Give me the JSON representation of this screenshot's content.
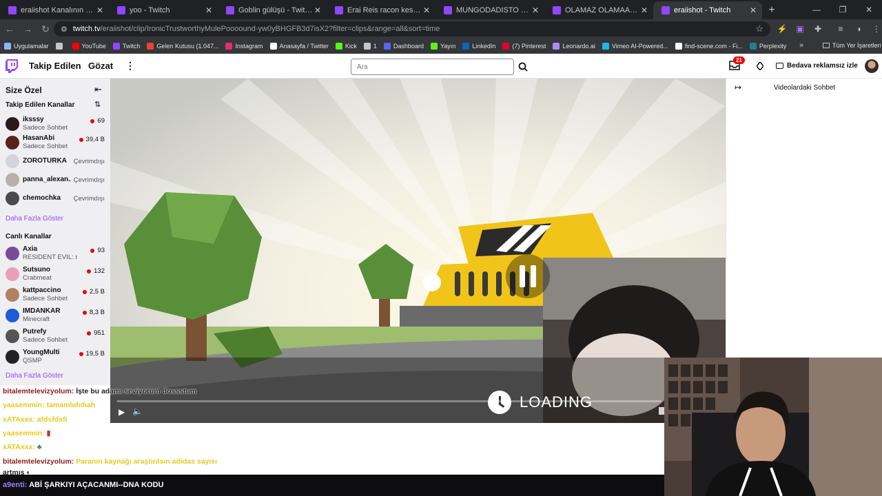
{
  "browser": {
    "tabs": [
      {
        "title": "eraiishot Kanalının Videoları - T",
        "active": false
      },
      {
        "title": "yoo - Twitch",
        "active": false
      },
      {
        "title": "Goblin gülüşü - Twitch",
        "active": false
      },
      {
        "title": "Erai Reis racon kesiyor - Twitch",
        "active": false
      },
      {
        "title": "MUNGODADISTO - Twitch",
        "active": false
      },
      {
        "title": "OLAMAZ OLAMAAZZZZ - Twit",
        "active": false
      },
      {
        "title": "eraiishot - Twitch",
        "active": true
      }
    ],
    "url_host": "twitch.tv",
    "url_path": "/eraiishot/clip/IronicTrustworthyMulePoooound-yw0yBHGFB3d7isX2?filter=clips&range=all&sort=time",
    "bookmarks": [
      {
        "label": "Uygulamalar",
        "color": "#8ab4f8"
      },
      {
        "label": "",
        "color": "#c4c7c5"
      },
      {
        "label": "YouTube",
        "color": "#ff0000"
      },
      {
        "label": "Twitch",
        "color": "#9146ff"
      },
      {
        "label": "Gelen Kutusu (1.047...",
        "color": "#ea4335"
      },
      {
        "label": "Instagram",
        "color": "#e1306c"
      },
      {
        "label": "Anasayfa / Twitter",
        "color": "#ffffff"
      },
      {
        "label": "Kick",
        "color": "#53fc18"
      },
      {
        "label": "1",
        "color": "#c4c7c5"
      },
      {
        "label": "Dashboard",
        "color": "#5865f2"
      },
      {
        "label": "Yayın",
        "color": "#53fc18"
      },
      {
        "label": "LinkedIn",
        "color": "#0a66c2"
      },
      {
        "label": "(7) Pinterest",
        "color": "#e60023"
      },
      {
        "label": "Leonardo.ai",
        "color": "#a98bff"
      },
      {
        "label": "Vimeo AI-Powered...",
        "color": "#1ab7ea"
      },
      {
        "label": "find-scene.com - Fi...",
        "color": "#ffffff"
      },
      {
        "label": "Perplexity",
        "color": "#20808d"
      }
    ],
    "all_bookmarks": "Tüm Yer İşaretleri"
  },
  "twitch": {
    "nav": {
      "following": "Takip Edilen",
      "browse": "Gözat",
      "more": "⋮"
    },
    "search_placeholder": "Ara",
    "notif_count": "21",
    "adfree_label": "Bedava reklamsız izle",
    "sidebar": {
      "title": "Size Özel",
      "followed_header": "Takip Edilen Kanallar",
      "followed": [
        {
          "name": "iksssy",
          "sub": "Sadece Sohbet",
          "viewers": "69",
          "live": true,
          "color": "#2a1a1a"
        },
        {
          "name": "HasanAbi",
          "sub": "Sadece Sohbet",
          "viewers": "39,4 B",
          "live": true,
          "color": "#5a2020"
        },
        {
          "name": "ZOROTURKA",
          "sub": "",
          "viewers": "Çevrimdışı",
          "live": false,
          "color": "#d4d4d8"
        },
        {
          "name": "panna_alexan...",
          "sub": "",
          "viewers": "Çevrimdışı",
          "live": false,
          "color": "#b8b0a8"
        },
        {
          "name": "chemochka",
          "sub": "",
          "viewers": "Çevrimdışı",
          "live": false,
          "color": "#4a4a4a"
        }
      ],
      "show_more": "Daha Fazla Göster",
      "live_header": "Canlı Kanallar",
      "live": [
        {
          "name": "Axia",
          "sub": "RESIDENT EVIL: r...",
          "viewers": "93",
          "color": "#7a4a9a"
        },
        {
          "name": "Sutsuno",
          "sub": "Crabmeat",
          "viewers": "132",
          "color": "#e8a0b8"
        },
        {
          "name": "kattpaccino",
          "sub": "Sadece Sohbet",
          "viewers": "2,5 B",
          "color": "#b08060"
        },
        {
          "name": "IMDANKAR",
          "sub": "Minecraft",
          "viewers": "8,3 B",
          "color": "#1e5bd8"
        },
        {
          "name": "Putrefy",
          "sub": "Sadece Sohbet",
          "viewers": "951",
          "color": "#555555"
        },
        {
          "name": "YoungMulti",
          "sub": "QSMP",
          "viewers": "19,5 B",
          "color": "#222222"
        }
      ]
    },
    "right_panel_title": "Videolardaki Sohbet",
    "player": {
      "loading_text": "LOADING"
    }
  },
  "chat_overlay": [
    {
      "user": "bitalemtelevizyolum:",
      "text": " İşte bu adamı seviyorum dossstum",
      "ucolor": "#8b1a1a",
      "tcolor": "#222222"
    },
    {
      "user": "yaasemmin:",
      "text": " tamamlıdıdıah",
      "ucolor": "#e8c820",
      "tcolor": "#e8c820"
    },
    {
      "user": "xATAxxx:",
      "text": " afdsfdsfi",
      "ucolor": "#e8c820",
      "tcolor": "#e8c820"
    },
    {
      "user": "yaasemmin:",
      "text": " ▮",
      "ucolor": "#e8c820",
      "tcolor": "#c0392b"
    },
    {
      "user": "xATAxxx:",
      "text": " ♣",
      "ucolor": "#e8c820",
      "tcolor": "#2e8b57"
    },
    {
      "user": "bitalemtelevizyolum:",
      "text": " Paranın kaynağı araştırılsın adidas sayısı",
      "ucolor": "#8b1a1a",
      "tcolor": "#e8c820"
    },
    {
      "user": "artmış",
      "text": " ◐",
      "ucolor": "#222222",
      "tcolor": "#222222"
    }
  ],
  "bottom_message": {
    "user": "a9enti:",
    "text": " ABİ ŞARKIYI AÇACANMI--DNA KODU"
  }
}
